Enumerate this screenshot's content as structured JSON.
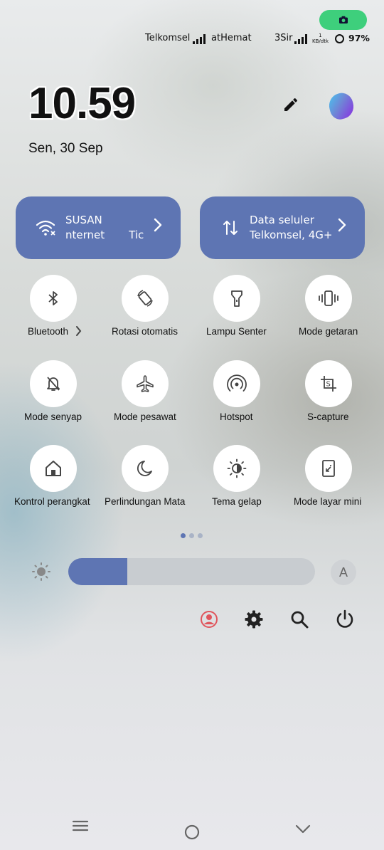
{
  "status_bar": {
    "carrier1": "Telkomsel",
    "carrier1_extra": "atHemat",
    "carrier2": "3Sir",
    "net_speed_top": "1",
    "net_speed_unit": "KB/dtk",
    "battery": "97%"
  },
  "header": {
    "time": "10.59",
    "date": "Sen, 30 Sep"
  },
  "wide_tiles": {
    "wifi": {
      "title": "SUSAN",
      "subtitle": "nternet",
      "subtitle_extra": "Tic"
    },
    "mobile": {
      "title": "Data seluler",
      "subtitle": "Telkomsel, 4G+"
    }
  },
  "tiles": [
    {
      "label": "Bluetooth",
      "icon": "bluetooth-icon"
    },
    {
      "label": "Rotasi otomatis",
      "icon": "rotate-icon"
    },
    {
      "label": "Lampu Senter",
      "icon": "flashlight-icon"
    },
    {
      "label": "Mode getaran",
      "icon": "vibrate-icon"
    },
    {
      "label": "Mode senyap",
      "icon": "bell-off-icon"
    },
    {
      "label": "Mode pesawat",
      "icon": "airplane-icon"
    },
    {
      "label": "Hotspot",
      "icon": "hotspot-icon"
    },
    {
      "label": "S-capture",
      "icon": "screenshot-icon"
    },
    {
      "label": "Kontrol perangkat",
      "icon": "home-icon"
    },
    {
      "label": "Perlindungan Mata",
      "icon": "moon-icon"
    },
    {
      "label": "Tema gelap",
      "icon": "dark-theme-icon"
    },
    {
      "label": "Mode layar mini",
      "icon": "mini-window-icon"
    }
  ],
  "brightness": {
    "level": 0.24,
    "auto_label": "A"
  },
  "colors": {
    "accent": "#5e75b3",
    "camera_pill": "#3ecf7c",
    "user_icon": "#e0555c"
  }
}
